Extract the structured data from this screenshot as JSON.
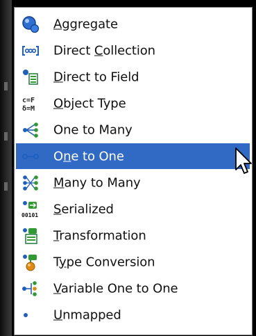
{
  "menu": {
    "items": [
      {
        "pre": "",
        "mn": "A",
        "post": "ggregate",
        "icon": "aggregate-icon",
        "selected": false
      },
      {
        "pre": "Direct ",
        "mn": "C",
        "post": "ollection",
        "icon": "direct-collection-icon",
        "selected": false
      },
      {
        "pre": "",
        "mn": "D",
        "post": "irect to Field",
        "icon": "direct-to-field-icon",
        "selected": false
      },
      {
        "pre": "",
        "mn": "O",
        "post": "bject Type",
        "icon": "object-type-icon",
        "selected": false
      },
      {
        "pre": "One to Many",
        "mn": "",
        "post": "",
        "icon": "one-to-many-icon",
        "selected": false
      },
      {
        "pre": "O",
        "mn": "n",
        "post": "e to One",
        "icon": "one-to-one-icon",
        "selected": true
      },
      {
        "pre": "",
        "mn": "M",
        "post": "any to Many",
        "icon": "many-to-many-icon",
        "selected": false
      },
      {
        "pre": "",
        "mn": "S",
        "post": "erialized",
        "icon": "serialized-icon",
        "selected": false
      },
      {
        "pre": "",
        "mn": "T",
        "post": "ransformation",
        "icon": "transformation-icon",
        "selected": false
      },
      {
        "pre": "T",
        "mn": "y",
        "post": "pe Conversion",
        "icon": "type-conversion-icon",
        "selected": false
      },
      {
        "pre": "",
        "mn": "V",
        "post": "ariable One to One",
        "icon": "variable-one-to-one-icon",
        "selected": false
      },
      {
        "pre": "",
        "mn": "U",
        "post": "nmapped",
        "icon": "unmapped-icon",
        "selected": false
      }
    ]
  },
  "colors": {
    "selection": "#316ac5",
    "icon_blue": "#1f5fbf",
    "icon_green": "#2f9a2f",
    "icon_orange": "#e08a10"
  },
  "cursor": {
    "icon": "mouse-pointer-icon"
  }
}
